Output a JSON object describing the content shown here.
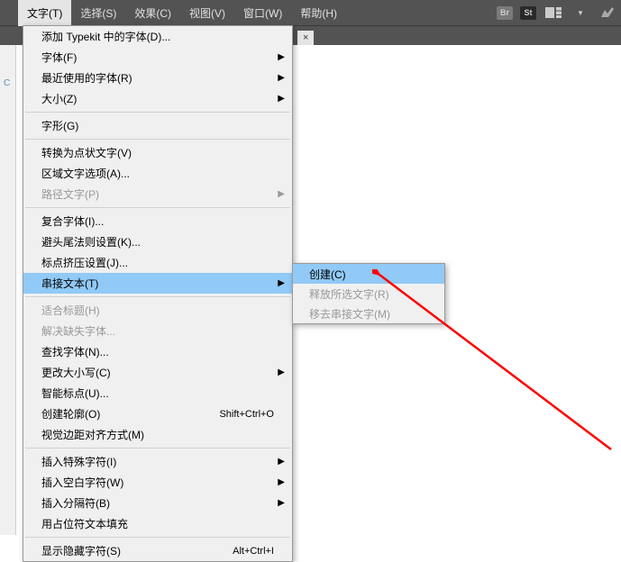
{
  "menubar": {
    "items": [
      {
        "label": "文字(T)",
        "active": true
      },
      {
        "label": "选择(S)"
      },
      {
        "label": "效果(C)"
      },
      {
        "label": "视图(V)"
      },
      {
        "label": "窗口(W)"
      },
      {
        "label": "帮助(H)"
      }
    ]
  },
  "sidebar": {
    "item": "C"
  },
  "tab": {
    "close": "×"
  },
  "dropdown": {
    "items": [
      {
        "label": "添加 Typekit 中的字体(D)..."
      },
      {
        "label": "字体(F)",
        "submenu": true
      },
      {
        "label": "最近使用的字体(R)",
        "submenu": true
      },
      {
        "label": "大小(Z)",
        "submenu": true
      },
      {
        "sep": true
      },
      {
        "label": "字形(G)"
      },
      {
        "sep": true
      },
      {
        "label": "转换为点状文字(V)"
      },
      {
        "label": "区域文字选项(A)..."
      },
      {
        "label": "路径文字(P)",
        "submenu": true,
        "disabled": true
      },
      {
        "sep": true
      },
      {
        "label": "复合字体(I)..."
      },
      {
        "label": "避头尾法则设置(K)..."
      },
      {
        "label": "标点挤压设置(J)..."
      },
      {
        "label": "串接文本(T)",
        "submenu": true,
        "highlighted": true
      },
      {
        "sep": true
      },
      {
        "label": "适合标题(H)",
        "disabled": true
      },
      {
        "label": "解决缺失字体...",
        "disabled": true
      },
      {
        "label": "查找字体(N)..."
      },
      {
        "label": "更改大小写(C)",
        "submenu": true
      },
      {
        "label": "智能标点(U)..."
      },
      {
        "label": "创建轮廓(O)",
        "shortcut": "Shift+Ctrl+O"
      },
      {
        "label": "视觉边距对齐方式(M)"
      },
      {
        "sep": true
      },
      {
        "label": "插入特殊字符(I)",
        "submenu": true
      },
      {
        "label": "插入空白字符(W)",
        "submenu": true
      },
      {
        "label": "插入分隔符(B)",
        "submenu": true
      },
      {
        "label": "用占位符文本填充"
      },
      {
        "sep": true
      },
      {
        "label": "显示隐藏字符(S)",
        "shortcut": "Alt+Ctrl+I"
      }
    ]
  },
  "submenu": {
    "items": [
      {
        "label": "创建(C)",
        "highlighted": true
      },
      {
        "label": "释放所选文字(R)",
        "disabled": true
      },
      {
        "label": "移去串接文字(M)",
        "disabled": true
      }
    ]
  }
}
